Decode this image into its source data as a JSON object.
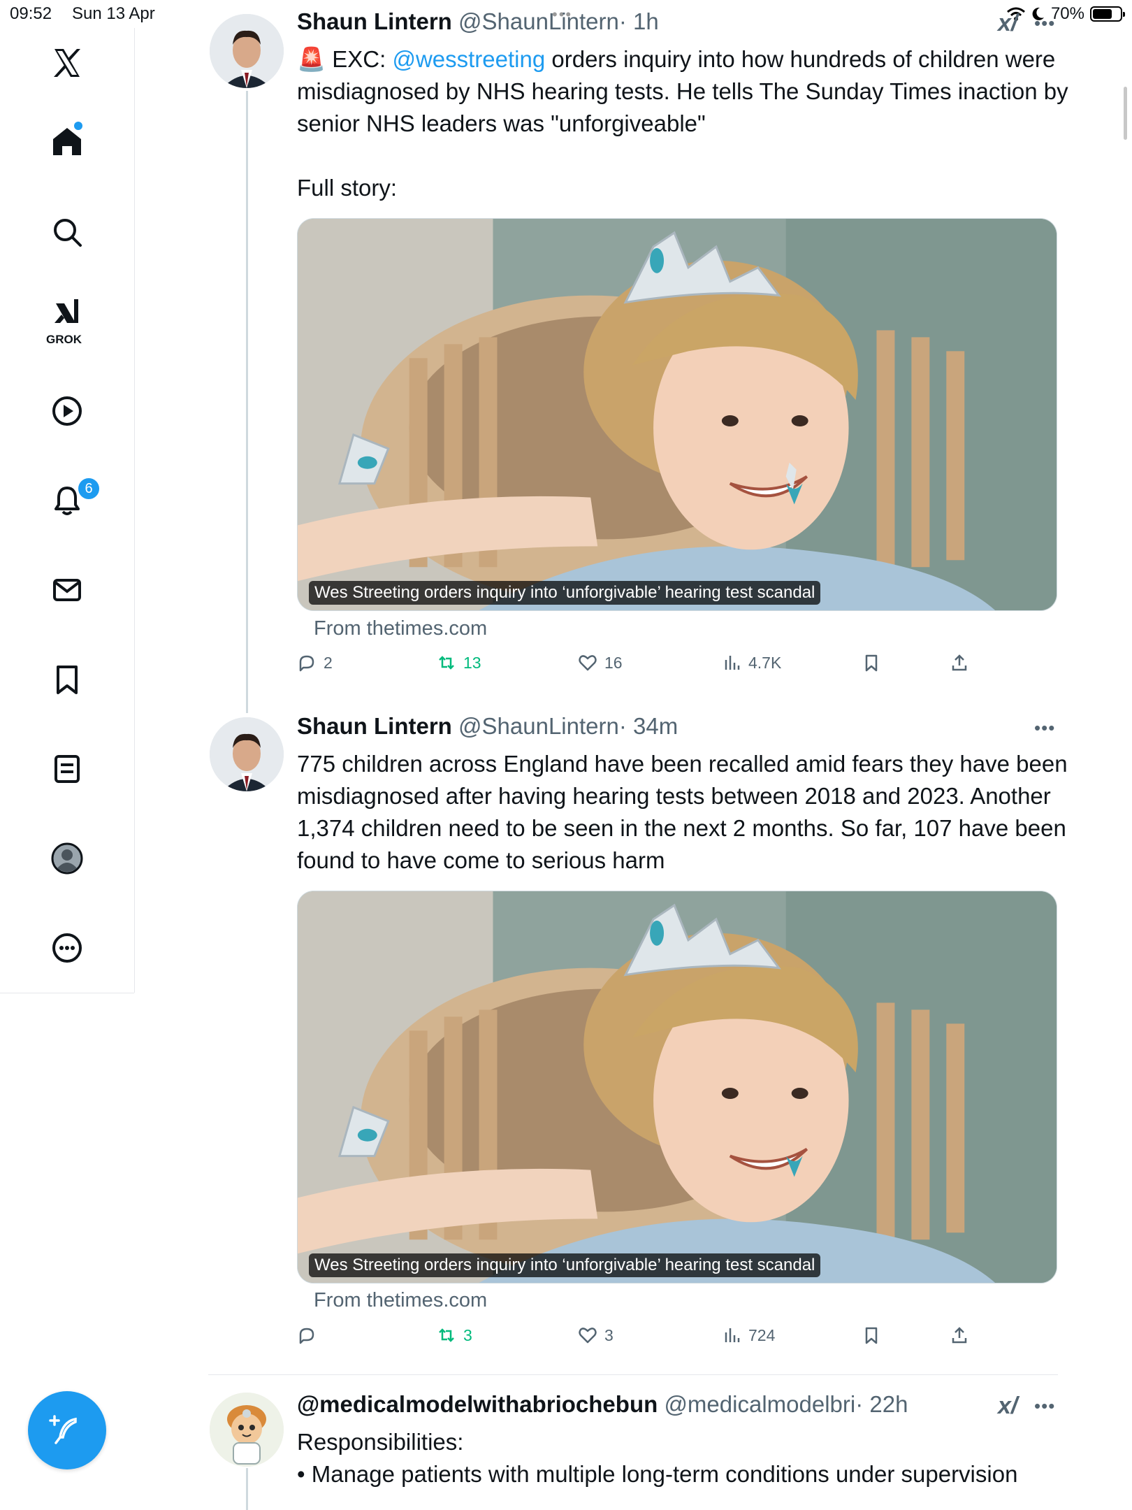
{
  "status_bar": {
    "time": "09:52",
    "date": "Sun 13 Apr",
    "battery": "70%",
    "battery_level": 0.7
  },
  "sidebar": {
    "items": [
      {
        "name": "x-logo-icon"
      },
      {
        "name": "home-icon"
      },
      {
        "name": "search-icon"
      },
      {
        "name": "grok-icon",
        "label": "GROK"
      },
      {
        "name": "video-icon"
      },
      {
        "name": "notifications-icon",
        "badge": "6"
      },
      {
        "name": "messages-icon"
      },
      {
        "name": "bookmarks-icon"
      },
      {
        "name": "lists-icon"
      },
      {
        "name": "profile-icon"
      },
      {
        "name": "more-icon"
      }
    ],
    "accent": "#1d9bf0"
  },
  "tweets": [
    {
      "name": "Shaun Lintern",
      "handle": "@ShaunLintern",
      "time": "· 1h",
      "text_prefix": "🚨 EXC: ",
      "mention": "@wesstreeting",
      "text_rest": " orders inquiry into how hundreds of children were misdiagnosed by NHS hearing tests. He tells The Sunday Times inaction by senior NHS leaders was \"unforgiveable\"",
      "text_extra": "Full story:",
      "card_caption": "Wes Streeting orders inquiry into ‘unforgivable’ hearing test scandal",
      "card_source": "From thetimes.com",
      "replies": "2",
      "retweets": "13",
      "likes": "16",
      "views": "4.7K"
    },
    {
      "name": "Shaun Lintern",
      "handle": "@ShaunLintern",
      "time": "· 34m",
      "text": "775 children across England have been recalled amid fears they have been misdiagnosed after having hearing tests between 2018 and 2023. Another 1,374 children need to be seen in the next 2 months. So far, 107 have been found to have come to serious harm",
      "card_caption": "Wes Streeting orders inquiry into ‘unforgivable’ hearing test scandal",
      "card_source": "From thetimes.com",
      "replies": "",
      "retweets": "3",
      "likes": "3",
      "views": "724"
    },
    {
      "name": "@medicalmodelwithabriochebun",
      "handle": "@medicalmodelbri",
      "time": "· 22h",
      "text": "Responsibilities:",
      "text2": "• Manage patients with multiple long-term conditions under supervision"
    }
  ],
  "colors": {
    "retweet": "#00ba7c",
    "muted": "#536471",
    "link": "#1d9bf0"
  }
}
